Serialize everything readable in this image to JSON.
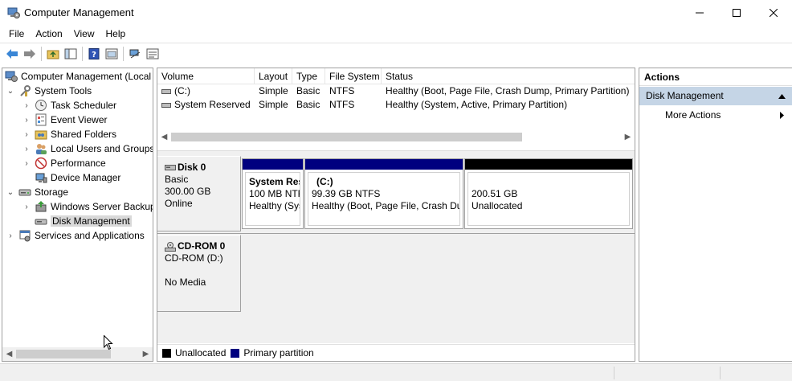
{
  "window": {
    "title": "Computer Management",
    "icon": "computer-management-icon"
  },
  "menu": [
    "File",
    "Action",
    "View",
    "Help"
  ],
  "toolbar": {
    "icons": [
      "back-arrow-icon",
      "forward-arrow-icon",
      "up-folder-icon",
      "show-hide-tree-icon",
      "help-icon",
      "properties-icon",
      "connect-icon",
      "list-view-icon"
    ]
  },
  "tree": {
    "root": "Computer Management (Local",
    "items": [
      {
        "label": "System Tools",
        "level": 1,
        "expanded": true
      },
      {
        "label": "Task Scheduler",
        "level": 2
      },
      {
        "label": "Event Viewer",
        "level": 2
      },
      {
        "label": "Shared Folders",
        "level": 2
      },
      {
        "label": "Local Users and Groups",
        "level": 2
      },
      {
        "label": "Performance",
        "level": 2
      },
      {
        "label": "Device Manager",
        "level": 2
      },
      {
        "label": "Storage",
        "level": 1,
        "expanded": true
      },
      {
        "label": "Windows Server Backup",
        "level": 2
      },
      {
        "label": "Disk Management",
        "level": 2,
        "selected": true
      },
      {
        "label": "Services and Applications",
        "level": 1
      }
    ]
  },
  "volumes": {
    "columns": [
      "Volume",
      "Layout",
      "Type",
      "File System",
      "Status"
    ],
    "rows": [
      {
        "volume": "(C:)",
        "layout": "Simple",
        "type": "Basic",
        "fs": "NTFS",
        "status": "Healthy (Boot, Page File, Crash Dump, Primary Partition)"
      },
      {
        "volume": "System Reserved",
        "layout": "Simple",
        "type": "Basic",
        "fs": "NTFS",
        "status": "Healthy (System, Active, Primary Partition)"
      }
    ]
  },
  "disks": {
    "disk0": {
      "name": "Disk 0",
      "type": "Basic",
      "size": "300.00 GB",
      "state": "Online",
      "partitions": [
        {
          "name": "System Res",
          "detail": "100 MB NTF",
          "status": "Healthy (Sys",
          "kind": "primary"
        },
        {
          "name": "(C:)",
          "detail": "99.39 GB NTFS",
          "status": "Healthy (Boot, Page File, Crash Dui",
          "kind": "primary"
        },
        {
          "name": "",
          "detail": "200.51 GB",
          "status": "Unallocated",
          "kind": "unallocated"
        }
      ]
    },
    "cdrom0": {
      "name": "CD-ROM 0",
      "drive": "CD-ROM (D:)",
      "media": "No Media"
    }
  },
  "legend": {
    "unallocated": "Unallocated",
    "primary": "Primary partition"
  },
  "actions": {
    "title": "Actions",
    "section": "Disk Management",
    "more": "More Actions"
  },
  "colors": {
    "primary_partition": "#00007f",
    "unallocated": "#000000",
    "selection": "#d9d9d9",
    "actions_header": "#c5d5e6"
  }
}
